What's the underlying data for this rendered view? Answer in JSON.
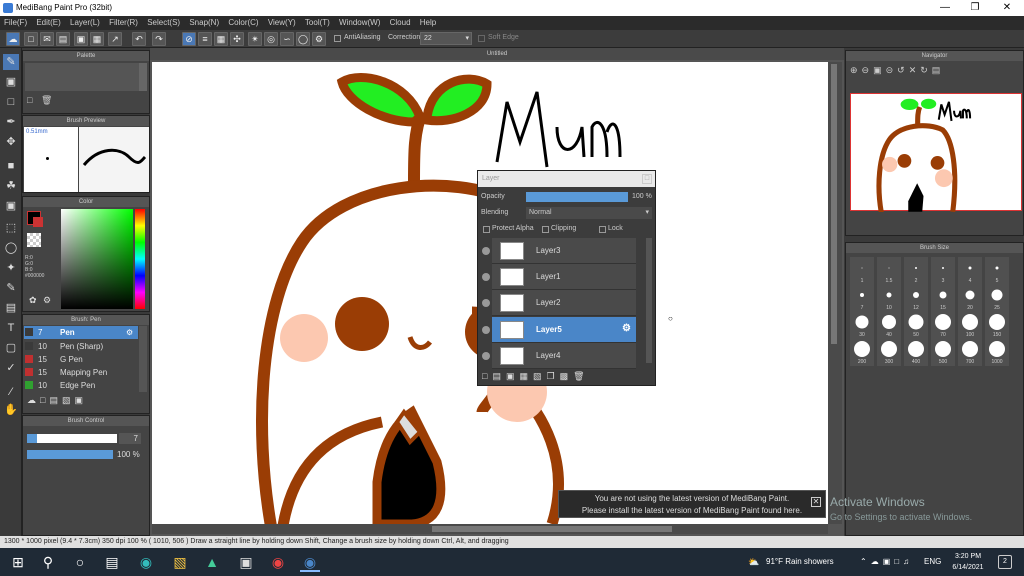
{
  "window": {
    "title": "MediBang Paint Pro (32bit)"
  },
  "menu": [
    "File(F)",
    "Edit(E)",
    "Layer(L)",
    "Filter(R)",
    "Select(S)",
    "Snap(N)",
    "Color(C)",
    "View(Y)",
    "Tool(T)",
    "Window(W)",
    "Cloud",
    "Help"
  ],
  "toolbar": {
    "antialiasing": "AntiAliasing",
    "correction_label": "Correction",
    "correction_value": "22",
    "soft_edge": "Soft Edge"
  },
  "panels": {
    "palette": "Palette",
    "brush_preview": "Brush Preview",
    "brush_preview_size": "0.51mm",
    "color": "Color",
    "rgb": [
      "R:0",
      "G:0",
      "B:0"
    ],
    "hex": "#000000",
    "brush": "Brush: Pen",
    "brush_items": [
      {
        "size": "7",
        "name": "Pen",
        "color": "#3a3a3a",
        "selected": true
      },
      {
        "size": "10",
        "name": "Pen (Sharp)",
        "color": "#3a3a3a",
        "selected": false
      },
      {
        "size": "15",
        "name": "G Pen",
        "color": "#c03030",
        "selected": false
      },
      {
        "size": "15",
        "name": "Mapping Pen",
        "color": "#c03030",
        "selected": false
      },
      {
        "size": "10",
        "name": "Edge Pen",
        "color": "#30a030",
        "selected": false
      }
    ],
    "brush_control": "Brush Control",
    "brush_size_val": "7",
    "opacity_val": "100 %",
    "navigator": "Navigator",
    "brush_size": "Brush Size"
  },
  "canvas": {
    "title": "Untitled",
    "doodle_text": "Mum"
  },
  "layer_panel": {
    "title": "Layer",
    "opacity_label": "Opacity",
    "opacity_value": "100 %",
    "blending_label": "Blending",
    "blending_value": "Normal",
    "protect_alpha": "Protect Alpha",
    "clipping": "Clipping",
    "lock": "Lock",
    "layers": [
      {
        "name": "Layer3",
        "selected": false
      },
      {
        "name": "Layer1",
        "selected": false
      },
      {
        "name": "Layer2",
        "selected": false
      },
      {
        "name": "Layer5",
        "selected": true
      },
      {
        "name": "Layer4",
        "selected": false
      }
    ]
  },
  "brush_sizes": [
    [
      "1",
      "1.5",
      "2",
      "3",
      "4",
      "5"
    ],
    [
      "7",
      "10",
      "12",
      "15",
      "20",
      "25"
    ],
    [
      "30",
      "40",
      "50",
      "70",
      "100",
      "150"
    ],
    [
      "200",
      "300",
      "400",
      "500",
      "700",
      "1000"
    ]
  ],
  "status": {
    "text": "1300 * 1000 pixel   (9.4 * 7.3cm)   350 dpi   100 %   ( 1010, 506 )   Draw a straight line by holding down Shift, Change a brush size by holding down Ctrl, Alt, and dragging"
  },
  "notification": {
    "line1": "You are not using the latest version of MediBang Paint.",
    "line2": "Please install the latest version of MediBang Paint found here."
  },
  "activate": {
    "title": "Activate Windows",
    "sub": "Go to Settings to activate Windows."
  },
  "taskbar": {
    "weather": "91°F  Rain showers",
    "lang": "ENG",
    "time": "3:20 PM",
    "date": "6/14/2021",
    "notif_count": "2"
  }
}
